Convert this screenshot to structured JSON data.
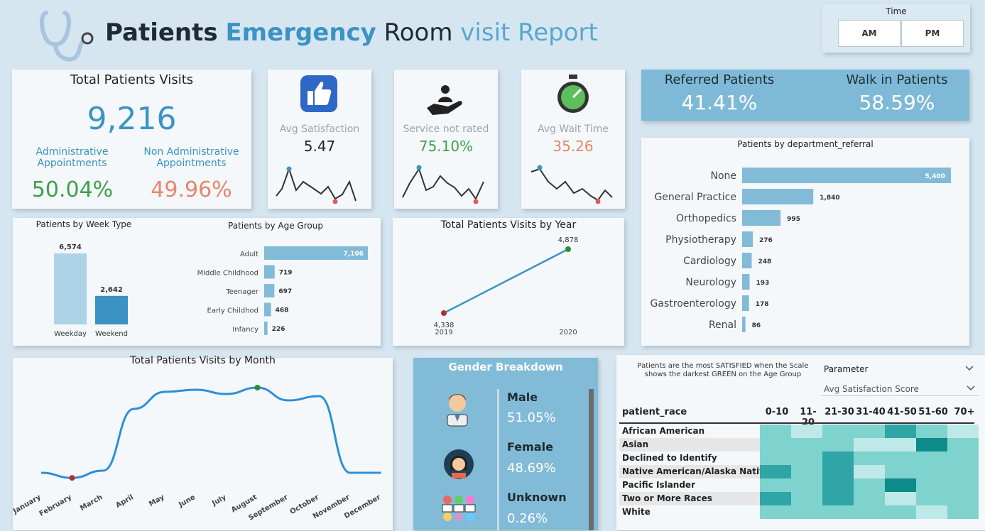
{
  "header": {
    "title_part1": "Patients",
    "title_part2": "Emergency",
    "title_part3": "Room",
    "title_part4": "visit Report"
  },
  "time_filter": {
    "label": "Time",
    "am": "AM",
    "pm": "PM"
  },
  "total_visits": {
    "title": "Total Patients Visits",
    "value": "9,216",
    "admin_label": "Administrative Appointments",
    "admin_value": "50.04%",
    "nonadmin_label": "Non Administrative Appointments",
    "nonadmin_value": "49.96%"
  },
  "kpis": [
    {
      "label": "Avg Satisfaction",
      "value": "5.47",
      "icon": "thumbs-up-icon"
    },
    {
      "label": "Service not rated",
      "value": "75.10%",
      "icon": "hand-service-icon"
    },
    {
      "label": "Avg Wait Time",
      "value": "35.26",
      "icon": "stopwatch-icon"
    }
  ],
  "referral": {
    "referred_label": "Referred Patients",
    "referred_value": "41.41%",
    "walkin_label": "Walk in Patients",
    "walkin_value": "58.59%"
  },
  "week_type": {
    "title": "Patients by Week Type",
    "chart_data": {
      "type": "bar",
      "categories": [
        "Weekday",
        "Weekend"
      ],
      "values": [
        6574,
        2642
      ],
      "labels": [
        "6,574",
        "2,642"
      ]
    }
  },
  "age_group": {
    "title": "Patients by Age Group",
    "chart_data": {
      "type": "bar",
      "categories": [
        "Adult",
        "Middle Childhood",
        "Teenager",
        "Early Childhod",
        "Infancy"
      ],
      "values": [
        7106,
        719,
        697,
        468,
        226
      ],
      "labels": [
        "7,106",
        "719",
        "697",
        "468",
        "226"
      ]
    }
  },
  "by_year": {
    "title": "Total Patients Visits by Year",
    "chart_data": {
      "type": "line",
      "categories": [
        "2019",
        "2020"
      ],
      "values": [
        4338,
        4878
      ],
      "labels": [
        "4,338",
        "4,878"
      ]
    }
  },
  "dept": {
    "title": "Patients by department_referral",
    "chart_data": {
      "type": "bar",
      "categories": [
        "None",
        "General Practice",
        "Orthopedics",
        "Physiotherapy",
        "Cardiology",
        "Neurology",
        "Gastroenterology",
        "Renal"
      ],
      "values": [
        5400,
        1840,
        995,
        276,
        248,
        193,
        178,
        86
      ],
      "labels": [
        "5,400",
        "1,840",
        "995",
        "276",
        "248",
        "193",
        "178",
        "86"
      ]
    }
  },
  "by_month": {
    "title": "Total Patients Visits by Month",
    "chart_data": {
      "type": "line",
      "categories": [
        "January",
        "February",
        "March",
        "April",
        "May",
        "June",
        "July",
        "August",
        "September",
        "October",
        "November",
        "December"
      ],
      "values": [
        0.3,
        0.18,
        0.35,
        1.8,
        2.2,
        2.25,
        2.15,
        2.3,
        2.0,
        2.1,
        0.3,
        0.3
      ]
    }
  },
  "gender": {
    "title": "Gender Breakdown",
    "items": [
      {
        "label": "Male",
        "value": "51.05%",
        "icon": "male-avatar-icon"
      },
      {
        "label": "Female",
        "value": "48.69%",
        "icon": "female-avatar-icon"
      },
      {
        "label": "Unknown",
        "value": "0.26%",
        "icon": "group-icon"
      }
    ]
  },
  "heatmap": {
    "note": "Patients are the most SATISFIED when the Scale shows the darkest GREEN on the Age Group",
    "parameter_label": "Parameter",
    "parameter_value": "Avg Satisfaction Score",
    "row_header": "patient_race",
    "columns": [
      "0-10",
      "11- 20",
      "21-30",
      "31-40",
      "41-50",
      "51-60",
      "70+"
    ],
    "rows": [
      "African American",
      "Asian",
      "Declined to Identify",
      "Native American/Alaska Native",
      "Pacific Islander",
      "Two or More Races",
      "White"
    ],
    "colors": {
      "light": "#bfe8e8",
      "mid": "#7fd3cf",
      "dark": "#2fa5a5",
      "darkest": "#0e8a8a"
    }
  }
}
